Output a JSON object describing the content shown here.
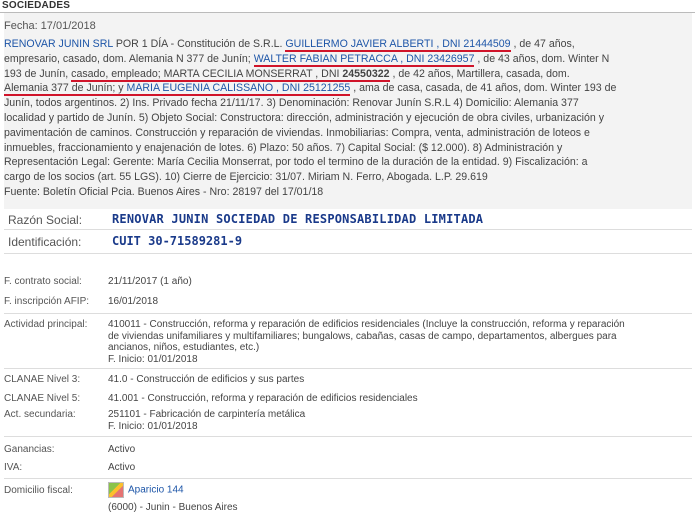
{
  "header": "SOCIEDADES",
  "fecha": "Fecha: 17/01/2018",
  "body_lines": [
    [
      {
        "t": "RENOVAR JUNIN SRL",
        "c": "lnk"
      },
      {
        "t": " POR 1 DÍA - Constitución de S.R.L. "
      },
      {
        "t": "GUILLERMO JAVIER ALBERTI , DNI 21444509",
        "c": "lnk ul"
      },
      {
        "t": " , de 47 años,"
      }
    ],
    [
      {
        "t": "empresario, casado, dom. Alemania N 377 de Junín; "
      },
      {
        "t": "WALTER FABIAN PETRACCA , DNI 23426957",
        "c": "lnk ul"
      },
      {
        "t": " , de 43 años, dom. Winter N"
      }
    ],
    [
      {
        "t": "193 de Junín, "
      },
      {
        "t": "casado, empleado; MARTA CECILIA MONSERRAT , DNI ",
        "c": "ul"
      },
      {
        "t": "24550322",
        "c": "ul bold"
      },
      {
        "t": " , de 42 años, Martillera, casada, dom."
      }
    ],
    [
      {
        "t": "Alemania 377 de Junín; y ",
        "c": "ul"
      },
      {
        "t": "MARIA EUGENIA CALISSANO , DNI 25121255",
        "c": "lnk ul"
      },
      {
        "t": " , ama de casa, casada, de 41 años, dom. Winter 193 de"
      }
    ],
    [
      {
        "t": "Junín, todos argentinos. 2) Ins. Privado fecha 21/11/17. 3) Denominación: Renovar Junín S.R.L 4) Domicilio: Alemania 377"
      }
    ],
    [
      {
        "t": "localidad y partido de Junín. 5) Objeto Social: Constructora: dirección, administración y ejecución de obra civiles, urbanización y"
      }
    ],
    [
      {
        "t": "pavimentación de caminos. Construcción y reparación de viviendas. Inmobiliarias: Compra, venta, administración de loteos e"
      }
    ],
    [
      {
        "t": "inmuebles, fraccionamiento y enajenación de lotes. 6) Plazo: 50 años. 7) Capital Social: ($ 12.000). 8) Administración y"
      }
    ],
    [
      {
        "t": "Representación Legal: Gerente: María Cecilia Monserrat, por todo el termino de la duración de la entidad. 9) Fiscalización: a"
      }
    ],
    [
      {
        "t": "cargo de los socios (art. 55 LGS). 10) Cierre de Ejercicio: 31/07. Miriam N. Ferro, Abogada. L.P. 29.619"
      }
    ],
    [
      {
        "t": "Fuente: Boletín Oficial Pcia. Buenos Aires - Nro: 28197 del 17/01/18"
      }
    ]
  ],
  "razon_social": {
    "label": "Razón Social:",
    "value": "RENOVAR JUNIN SOCIEDAD DE RESPONSABILIDAD LIMITADA"
  },
  "identificacion": {
    "label": "Identificación:",
    "value": "CUIT 30-71589281-9"
  },
  "rows": {
    "contrato": {
      "label": "F. contrato social:",
      "value": "21/11/2017 (1 año)"
    },
    "afip": {
      "label": "F. inscripción AFIP:",
      "value": "16/01/2018"
    },
    "actividad": {
      "label": "Actividad principal:",
      "lines": [
        "410011 - Construcción, reforma y reparación de edificios residenciales (Incluye la construcción, reforma y reparación",
        "de viviendas unifamiliares y multifamiliares; bungalows, cabañas, casas de campo, departamentos, albergues para",
        "ancianos, niños, estudiantes, etc.)"
      ],
      "inicio_label": "F. Inicio:",
      "inicio": "01/01/2018"
    },
    "clanae3": {
      "label": "CLANAE Nivel 3:",
      "value": "41.0 - Construcción de edificios y sus partes"
    },
    "clanae5": {
      "label": "CLANAE Nivel 5:",
      "value": "41.001 - Construcción, reforma y reparación de edificios residenciales"
    },
    "secundaria": {
      "label": "Act. secundaria:",
      "value": "251101 - Fabricación de carpintería metálica",
      "inicio_label": "F. Inicio:",
      "inicio": "01/01/2018"
    },
    "ganancias": {
      "label": "Ganancias:",
      "value": "Activo"
    },
    "iva": {
      "label": "IVA:",
      "value": "Activo"
    },
    "domicilio": {
      "label": "Domicilio fiscal:",
      "link": "Aparicio 144",
      "line2": "(6000) - Junin - Buenos Aires"
    }
  }
}
